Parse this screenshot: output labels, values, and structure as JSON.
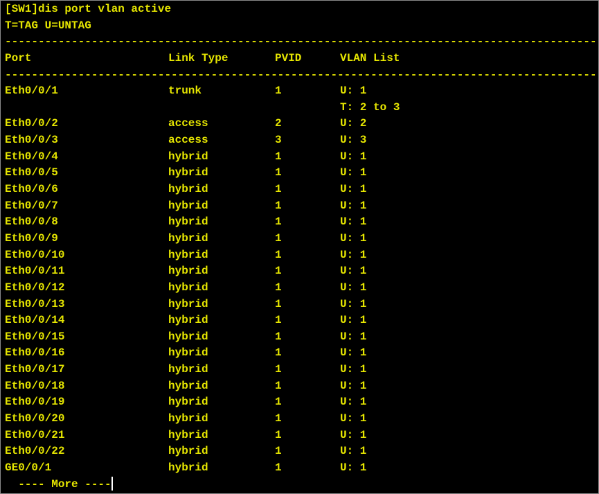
{
  "terminal": {
    "command_line": "[SW1]dis port vlan active",
    "legend": "T=TAG U=UNTAG",
    "separator": "-------------------------------------------------------------------------------------------------------------",
    "more_prompt": "  ---- More ----"
  },
  "table": {
    "headers": {
      "port": "Port",
      "link_type": "Link Type",
      "pvid": "PVID",
      "vlan_list": "VLAN List"
    },
    "rows": [
      {
        "port": "Eth0/0/1",
        "link_type": "trunk",
        "pvid": "1",
        "vlan": "U: 1"
      },
      {
        "port": "",
        "link_type": "",
        "pvid": "",
        "vlan": "T: 2 to 3"
      },
      {
        "port": "Eth0/0/2",
        "link_type": "access",
        "pvid": "2",
        "vlan": "U: 2"
      },
      {
        "port": "Eth0/0/3",
        "link_type": "access",
        "pvid": "3",
        "vlan": "U: 3"
      },
      {
        "port": "Eth0/0/4",
        "link_type": "hybrid",
        "pvid": "1",
        "vlan": "U: 1"
      },
      {
        "port": "Eth0/0/5",
        "link_type": "hybrid",
        "pvid": "1",
        "vlan": "U: 1"
      },
      {
        "port": "Eth0/0/6",
        "link_type": "hybrid",
        "pvid": "1",
        "vlan": "U: 1"
      },
      {
        "port": "Eth0/0/7",
        "link_type": "hybrid",
        "pvid": "1",
        "vlan": "U: 1"
      },
      {
        "port": "Eth0/0/8",
        "link_type": "hybrid",
        "pvid": "1",
        "vlan": "U: 1"
      },
      {
        "port": "Eth0/0/9",
        "link_type": "hybrid",
        "pvid": "1",
        "vlan": "U: 1"
      },
      {
        "port": "Eth0/0/10",
        "link_type": "hybrid",
        "pvid": "1",
        "vlan": "U: 1"
      },
      {
        "port": "Eth0/0/11",
        "link_type": "hybrid",
        "pvid": "1",
        "vlan": "U: 1"
      },
      {
        "port": "Eth0/0/12",
        "link_type": "hybrid",
        "pvid": "1",
        "vlan": "U: 1"
      },
      {
        "port": "Eth0/0/13",
        "link_type": "hybrid",
        "pvid": "1",
        "vlan": "U: 1"
      },
      {
        "port": "Eth0/0/14",
        "link_type": "hybrid",
        "pvid": "1",
        "vlan": "U: 1"
      },
      {
        "port": "Eth0/0/15",
        "link_type": "hybrid",
        "pvid": "1",
        "vlan": "U: 1"
      },
      {
        "port": "Eth0/0/16",
        "link_type": "hybrid",
        "pvid": "1",
        "vlan": "U: 1"
      },
      {
        "port": "Eth0/0/17",
        "link_type": "hybrid",
        "pvid": "1",
        "vlan": "U: 1"
      },
      {
        "port": "Eth0/0/18",
        "link_type": "hybrid",
        "pvid": "1",
        "vlan": "U: 1"
      },
      {
        "port": "Eth0/0/19",
        "link_type": "hybrid",
        "pvid": "1",
        "vlan": "U: 1"
      },
      {
        "port": "Eth0/0/20",
        "link_type": "hybrid",
        "pvid": "1",
        "vlan": "U: 1"
      },
      {
        "port": "Eth0/0/21",
        "link_type": "hybrid",
        "pvid": "1",
        "vlan": "U: 1"
      },
      {
        "port": "Eth0/0/22",
        "link_type": "hybrid",
        "pvid": "1",
        "vlan": "U: 1"
      },
      {
        "port": "GE0/0/1",
        "link_type": "hybrid",
        "pvid": "1",
        "vlan": "U: 1"
      }
    ]
  },
  "colors": {
    "text": "#e6e600",
    "background": "#000000",
    "cursor": "#ffffff"
  }
}
